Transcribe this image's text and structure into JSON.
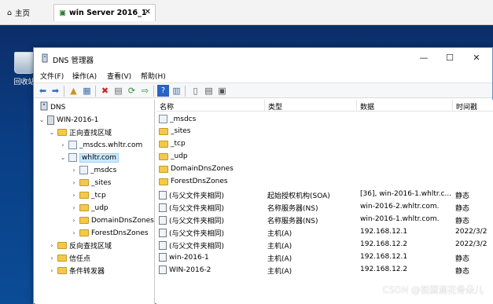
{
  "browser": {
    "home_tab": "主页",
    "vm_tab": "win Server 2016_1"
  },
  "desktop": {
    "recycle_bin": "回收站"
  },
  "window": {
    "title": "DNS 管理器",
    "menu": [
      "文件(F)",
      "操作(A)",
      "查看(V)",
      "帮助(H)"
    ]
  },
  "tree": {
    "root": "DNS",
    "server": "WIN-2016-1",
    "forward": "正向查找区域",
    "msdcs_zone": "_msdcs.whltr.com",
    "whltr": "whltr.com",
    "sub": [
      "_msdcs",
      "_sites",
      "_tcp",
      "_udp",
      "DomainDnsZones",
      "ForestDnsZones"
    ],
    "reverse": "反向查找区域",
    "trust": "信任点",
    "forwarders": "条件转发器"
  },
  "list": {
    "headers": {
      "name": "名称",
      "type": "类型",
      "data": "数据",
      "timestamp": "时间戳"
    },
    "rows": [
      {
        "name": "_msdcs",
        "type": "",
        "data": "",
        "timestamp": "",
        "icon": "zone-icon"
      },
      {
        "name": "_sites",
        "type": "",
        "data": "",
        "timestamp": "",
        "icon": "folder-icon"
      },
      {
        "name": "_tcp",
        "type": "",
        "data": "",
        "timestamp": "",
        "icon": "folder-icon"
      },
      {
        "name": "_udp",
        "type": "",
        "data": "",
        "timestamp": "",
        "icon": "folder-icon"
      },
      {
        "name": "DomainDnsZones",
        "type": "",
        "data": "",
        "timestamp": "",
        "icon": "folder-icon"
      },
      {
        "name": "ForestDnsZones",
        "type": "",
        "data": "",
        "timestamp": "",
        "icon": "folder-icon"
      },
      {
        "name": "(与父文件夹相同)",
        "type": "起始授权机构(SOA)",
        "data": "[36], win-2016-1.whltr.c...",
        "timestamp": "静态",
        "icon": "record-icon"
      },
      {
        "name": "(与父文件夹相同)",
        "type": "名称服务器(NS)",
        "data": "win-2016-2.whltr.com.",
        "timestamp": "静态",
        "icon": "record-icon"
      },
      {
        "name": "(与父文件夹相同)",
        "type": "名称服务器(NS)",
        "data": "win-2016-1.whltr.com.",
        "timestamp": "静态",
        "icon": "record-icon"
      },
      {
        "name": "(与父文件夹相同)",
        "type": "主机(A)",
        "data": "192.168.12.1",
        "timestamp": "2022/3/2",
        "icon": "record-icon"
      },
      {
        "name": "(与父文件夹相同)",
        "type": "主机(A)",
        "data": "192.168.12.2",
        "timestamp": "2022/3/2",
        "icon": "record-icon"
      },
      {
        "name": "win-2016-1",
        "type": "主机(A)",
        "data": "192.168.12.1",
        "timestamp": "静态",
        "icon": "record-icon"
      },
      {
        "name": "WIN-2016-2",
        "type": "主机(A)",
        "data": "192.168.12.2",
        "timestamp": "静态",
        "icon": "record-icon"
      }
    ]
  },
  "watermark": "CSDN @祖国滴花骨朵儿",
  "colors": {
    "desktop": "#0a3f86",
    "selection": "#cce8ff",
    "folder": "#f3c94c"
  }
}
